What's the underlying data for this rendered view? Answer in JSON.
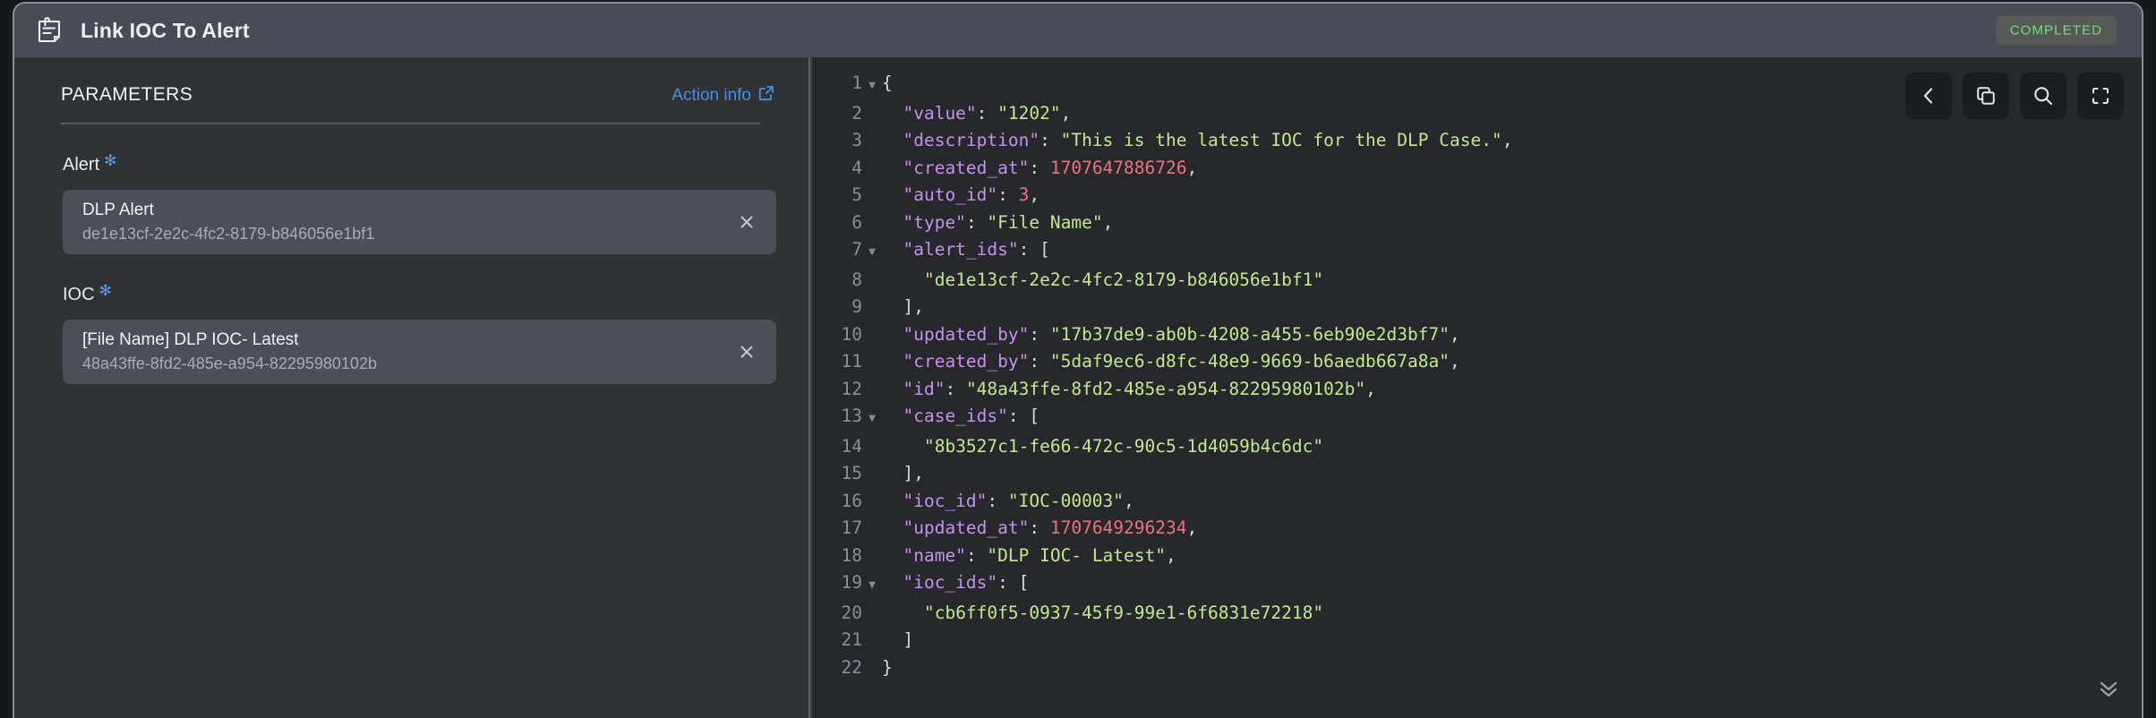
{
  "header": {
    "title": "Link IOC To Alert",
    "icon": "clipboard-note-icon",
    "status": "COMPLETED",
    "status_color": "#6fe07a"
  },
  "parameters_panel": {
    "section_title": "PARAMETERS",
    "action_info_label": "Action info",
    "action_info_icon": "external-link-icon",
    "required_marker": "✻",
    "fields": [
      {
        "label": "Alert",
        "required": true,
        "chip_primary": "DLP Alert",
        "chip_secondary": "de1e13cf-2e2c-4fc2-8179-b846056e1bf1",
        "clear_icon": "close-icon"
      },
      {
        "label": "IOC",
        "required": true,
        "chip_primary": "[File Name] DLP IOC- Latest",
        "chip_secondary": "48a43ffe-8fd2-485e-a954-82295980102b",
        "clear_icon": "close-icon"
      }
    ]
  },
  "code_panel": {
    "language": "json",
    "toolbar": [
      {
        "name": "collapse-left-button",
        "icon": "chevron-left-icon"
      },
      {
        "name": "copy-button",
        "icon": "copy-icon"
      },
      {
        "name": "search-button",
        "icon": "search-icon"
      },
      {
        "name": "fullscreen-button",
        "icon": "fullscreen-icon"
      }
    ],
    "scroll_down_icon": "double-chevron-down-icon",
    "syntax_colors": {
      "key": "#c792ea",
      "string": "#c3e88d",
      "number": "#f07178",
      "punctuation": "#d6d9dd",
      "line_number": "#8b9097"
    },
    "lines": [
      {
        "num": 1,
        "fold": true,
        "tokens": [
          {
            "t": "p",
            "v": "{"
          }
        ]
      },
      {
        "num": 2,
        "fold": false,
        "tokens": [
          {
            "t": "p",
            "v": "  "
          },
          {
            "t": "k",
            "v": "\"value\""
          },
          {
            "t": "p",
            "v": ": "
          },
          {
            "t": "s",
            "v": "\"1202\""
          },
          {
            "t": "p",
            "v": ","
          }
        ]
      },
      {
        "num": 3,
        "fold": false,
        "tokens": [
          {
            "t": "p",
            "v": "  "
          },
          {
            "t": "k",
            "v": "\"description\""
          },
          {
            "t": "p",
            "v": ": "
          },
          {
            "t": "s",
            "v": "\"This is the latest IOC for the DLP Case.\""
          },
          {
            "t": "p",
            "v": ","
          }
        ]
      },
      {
        "num": 4,
        "fold": false,
        "tokens": [
          {
            "t": "p",
            "v": "  "
          },
          {
            "t": "k",
            "v": "\"created_at\""
          },
          {
            "t": "p",
            "v": ": "
          },
          {
            "t": "n",
            "v": "1707647886726"
          },
          {
            "t": "p",
            "v": ","
          }
        ]
      },
      {
        "num": 5,
        "fold": false,
        "tokens": [
          {
            "t": "p",
            "v": "  "
          },
          {
            "t": "k",
            "v": "\"auto_id\""
          },
          {
            "t": "p",
            "v": ": "
          },
          {
            "t": "n",
            "v": "3"
          },
          {
            "t": "p",
            "v": ","
          }
        ]
      },
      {
        "num": 6,
        "fold": false,
        "tokens": [
          {
            "t": "p",
            "v": "  "
          },
          {
            "t": "k",
            "v": "\"type\""
          },
          {
            "t": "p",
            "v": ": "
          },
          {
            "t": "s",
            "v": "\"File Name\""
          },
          {
            "t": "p",
            "v": ","
          }
        ]
      },
      {
        "num": 7,
        "fold": true,
        "tokens": [
          {
            "t": "p",
            "v": "  "
          },
          {
            "t": "k",
            "v": "\"alert_ids\""
          },
          {
            "t": "p",
            "v": ": ["
          }
        ]
      },
      {
        "num": 8,
        "fold": false,
        "tokens": [
          {
            "t": "p",
            "v": "    "
          },
          {
            "t": "s",
            "v": "\"de1e13cf-2e2c-4fc2-8179-b846056e1bf1\""
          }
        ]
      },
      {
        "num": 9,
        "fold": false,
        "tokens": [
          {
            "t": "p",
            "v": "  ],"
          }
        ]
      },
      {
        "num": 10,
        "fold": false,
        "tokens": [
          {
            "t": "p",
            "v": "  "
          },
          {
            "t": "k",
            "v": "\"updated_by\""
          },
          {
            "t": "p",
            "v": ": "
          },
          {
            "t": "s",
            "v": "\"17b37de9-ab0b-4208-a455-6eb90e2d3bf7\""
          },
          {
            "t": "p",
            "v": ","
          }
        ]
      },
      {
        "num": 11,
        "fold": false,
        "tokens": [
          {
            "t": "p",
            "v": "  "
          },
          {
            "t": "k",
            "v": "\"created_by\""
          },
          {
            "t": "p",
            "v": ": "
          },
          {
            "t": "s",
            "v": "\"5daf9ec6-d8fc-48e9-9669-b6aedb667a8a\""
          },
          {
            "t": "p",
            "v": ","
          }
        ]
      },
      {
        "num": 12,
        "fold": false,
        "tokens": [
          {
            "t": "p",
            "v": "  "
          },
          {
            "t": "k",
            "v": "\"id\""
          },
          {
            "t": "p",
            "v": ": "
          },
          {
            "t": "s",
            "v": "\"48a43ffe-8fd2-485e-a954-82295980102b\""
          },
          {
            "t": "p",
            "v": ","
          }
        ]
      },
      {
        "num": 13,
        "fold": true,
        "tokens": [
          {
            "t": "p",
            "v": "  "
          },
          {
            "t": "k",
            "v": "\"case_ids\""
          },
          {
            "t": "p",
            "v": ": ["
          }
        ]
      },
      {
        "num": 14,
        "fold": false,
        "tokens": [
          {
            "t": "p",
            "v": "    "
          },
          {
            "t": "s",
            "v": "\"8b3527c1-fe66-472c-90c5-1d4059b4c6dc\""
          }
        ]
      },
      {
        "num": 15,
        "fold": false,
        "tokens": [
          {
            "t": "p",
            "v": "  ],"
          }
        ]
      },
      {
        "num": 16,
        "fold": false,
        "tokens": [
          {
            "t": "p",
            "v": "  "
          },
          {
            "t": "k",
            "v": "\"ioc_id\""
          },
          {
            "t": "p",
            "v": ": "
          },
          {
            "t": "s",
            "v": "\"IOC-00003\""
          },
          {
            "t": "p",
            "v": ","
          }
        ]
      },
      {
        "num": 17,
        "fold": false,
        "tokens": [
          {
            "t": "p",
            "v": "  "
          },
          {
            "t": "k",
            "v": "\"updated_at\""
          },
          {
            "t": "p",
            "v": ": "
          },
          {
            "t": "n",
            "v": "1707649296234"
          },
          {
            "t": "p",
            "v": ","
          }
        ]
      },
      {
        "num": 18,
        "fold": false,
        "tokens": [
          {
            "t": "p",
            "v": "  "
          },
          {
            "t": "k",
            "v": "\"name\""
          },
          {
            "t": "p",
            "v": ": "
          },
          {
            "t": "s",
            "v": "\"DLP IOC- Latest\""
          },
          {
            "t": "p",
            "v": ","
          }
        ]
      },
      {
        "num": 19,
        "fold": true,
        "tokens": [
          {
            "t": "p",
            "v": "  "
          },
          {
            "t": "k",
            "v": "\"ioc_ids\""
          },
          {
            "t": "p",
            "v": ": ["
          }
        ]
      },
      {
        "num": 20,
        "fold": false,
        "tokens": [
          {
            "t": "p",
            "v": "    "
          },
          {
            "t": "s",
            "v": "\"cb6ff0f5-0937-45f9-99e1-6f6831e72218\""
          }
        ]
      },
      {
        "num": 21,
        "fold": false,
        "tokens": [
          {
            "t": "p",
            "v": "  ]"
          }
        ]
      },
      {
        "num": 22,
        "fold": false,
        "tokens": [
          {
            "t": "p",
            "v": "}"
          }
        ]
      }
    ]
  }
}
